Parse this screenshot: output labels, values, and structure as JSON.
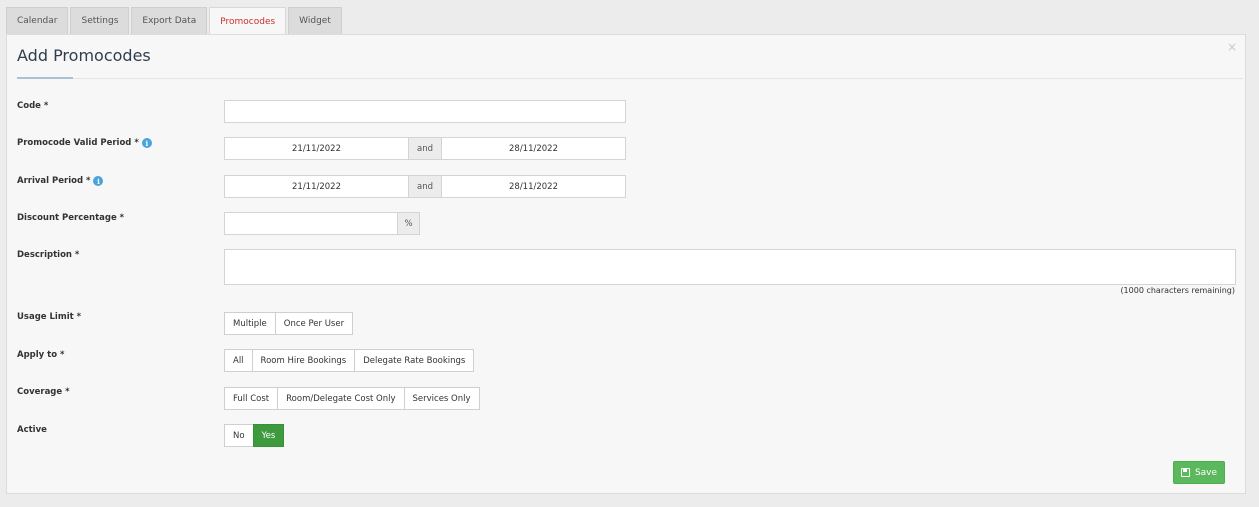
{
  "tabs": [
    {
      "label": "Calendar",
      "active": false
    },
    {
      "label": "Settings",
      "active": false
    },
    {
      "label": "Export Data",
      "active": false
    },
    {
      "label": "Promocodes",
      "active": true
    },
    {
      "label": "Widget",
      "active": false
    }
  ],
  "panel": {
    "title": "Add Promocodes",
    "close_glyph": "×"
  },
  "form": {
    "code": {
      "label": "Code *",
      "value": ""
    },
    "valid_period": {
      "label": "Promocode Valid Period *",
      "from": "21/11/2022",
      "joiner": "and",
      "to": "28/11/2022"
    },
    "arrival_period": {
      "label": "Arrival Period *",
      "from": "21/11/2022",
      "joiner": "and",
      "to": "28/11/2022"
    },
    "discount": {
      "label": "Discount Percentage *",
      "value": "",
      "suffix": "%"
    },
    "description": {
      "label": "Description *",
      "value": "",
      "remaining": "(1000 characters remaining)"
    },
    "usage_limit": {
      "label": "Usage Limit *",
      "options": [
        "Multiple",
        "Once Per User"
      ],
      "selected": null
    },
    "apply_to": {
      "label": "Apply to *",
      "options": [
        "All",
        "Room Hire Bookings",
        "Delegate Rate Bookings"
      ],
      "selected": null
    },
    "coverage": {
      "label": "Coverage *",
      "options": [
        "Full Cost",
        "Room/Delegate Cost Only",
        "Services Only"
      ],
      "selected": null
    },
    "active": {
      "label": "Active",
      "options": [
        "No",
        "Yes"
      ],
      "selected": "Yes"
    }
  },
  "info_glyph": "i",
  "save_label": "Save",
  "icons": {
    "info": "info-icon",
    "save": "floppy-disk-icon",
    "close": "close-icon"
  },
  "colors": {
    "active_tab_text": "#c9302c",
    "success": "#5cb85c",
    "info": "#4aa3d9"
  }
}
